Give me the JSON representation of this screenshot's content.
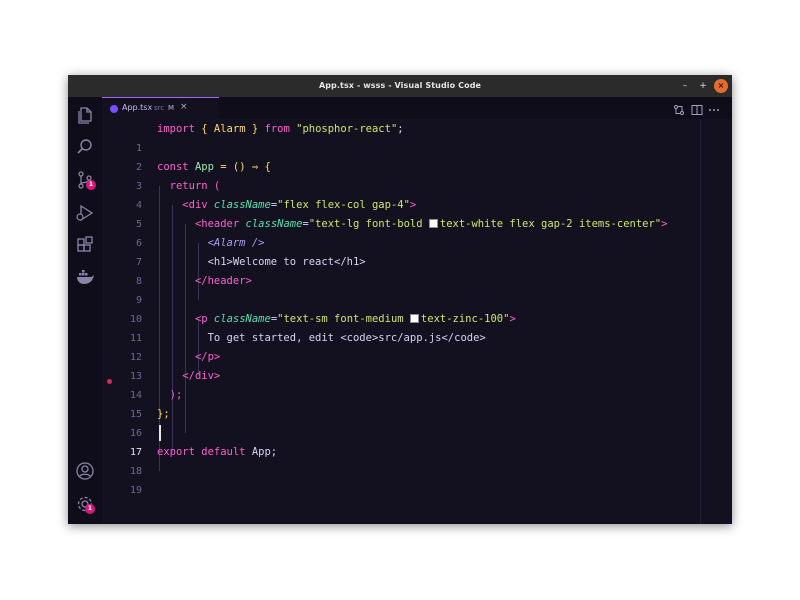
{
  "window": {
    "title": "App.tsx - wsss - Visual Studio Code"
  },
  "window_controls": {
    "minimize": "–",
    "maximize": "+",
    "close": "×"
  },
  "activity_bar": {
    "icons": [
      "files-icon",
      "search-icon",
      "source-control-icon",
      "run-debug-icon",
      "extensions-icon",
      "docker-icon",
      "account-icon",
      "settings-gear-icon"
    ],
    "source_control_badge": "1",
    "settings_badge": "1"
  },
  "tab": {
    "filename": "App.tsx",
    "folder": "src",
    "status": "M",
    "close": "×"
  },
  "editor": {
    "active_line": 17,
    "breakpoint_line": 14,
    "lines": [
      {
        "n": "1"
      },
      {
        "n": "2"
      },
      {
        "n": "3"
      },
      {
        "n": "4"
      },
      {
        "n": "5"
      },
      {
        "n": "6"
      },
      {
        "n": "7"
      },
      {
        "n": "8"
      },
      {
        "n": "9"
      },
      {
        "n": "10"
      },
      {
        "n": "11"
      },
      {
        "n": "12"
      },
      {
        "n": "13"
      },
      {
        "n": "14"
      },
      {
        "n": "15"
      },
      {
        "n": "16"
      },
      {
        "n": "17"
      },
      {
        "n": "18"
      },
      {
        "n": "19"
      }
    ],
    "tokens": {
      "import": "import",
      "alarm_import": "{ Alarm }",
      "from": "from",
      "module": "\"phosphor-react\"",
      "semi": ";",
      "const": "const",
      "app": "App",
      "arrow": "= () ⇒ {",
      "return": "return",
      "open_paren": "(",
      "div_open": "<div",
      "classname": "className",
      "eq": "=",
      "div_class": "\"flex flex-col gap-4\"",
      "gt": ">",
      "header_open": "<header",
      "header_class_1": "\"text-lg font-bold ",
      "header_class_2": "text-white flex gap-2 items-center\"",
      "alarm_tag": "<Alarm />",
      "h1_line": "<h1>Welcome to react</h1>",
      "header_close": "</header>",
      "p_open": "<p",
      "p_class_1": "\"text-sm font-medium ",
      "p_class_2": "text-zinc-100\"",
      "p_text": "To get started, edit <code>src/app.js</code>",
      "p_close": "</p>",
      "div_close": "</div>",
      "close_paren": ");",
      "close_brace": "};",
      "export": "export default",
      "export_app": "App;"
    }
  },
  "colors": {
    "editor_bg": "#13111f",
    "keyword": "#ff5fd0",
    "string": "#cbe86b",
    "bracket": "#ffd86b",
    "attribute": "#56e0b0",
    "badge": "#d6187b",
    "close_button": "#e66b2f"
  }
}
